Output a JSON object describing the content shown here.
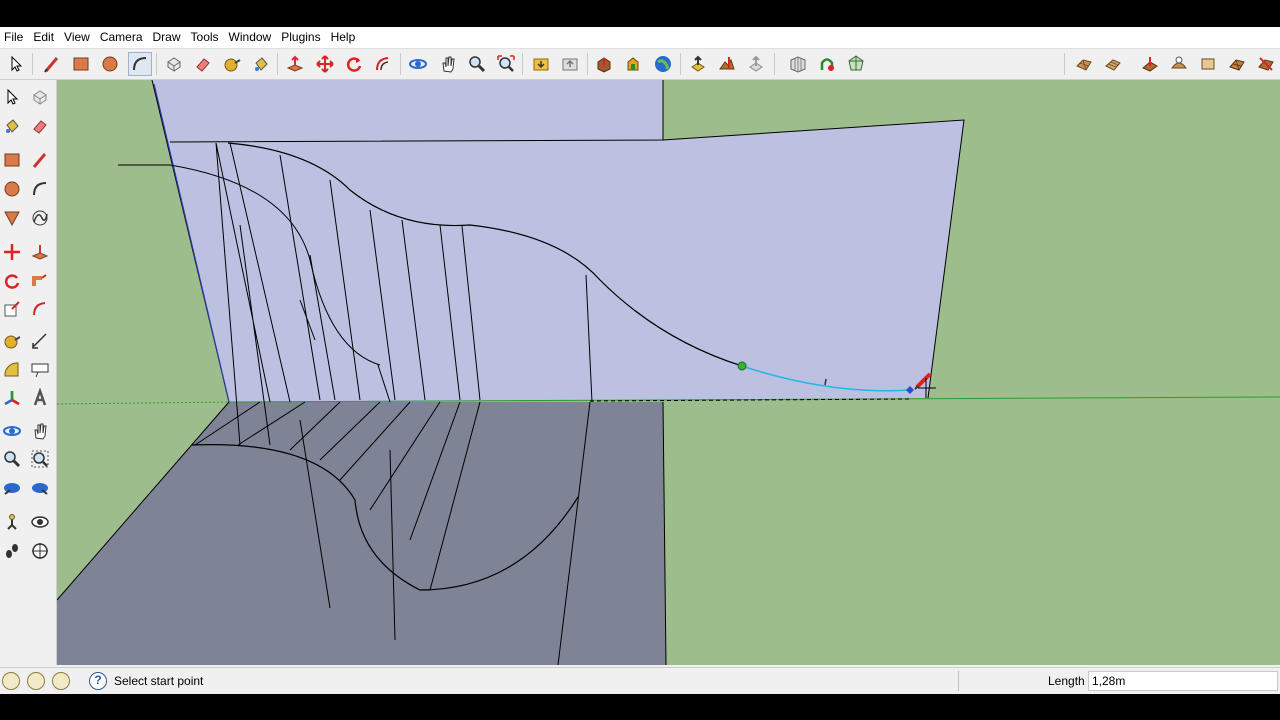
{
  "menu": [
    "File",
    "Edit",
    "View",
    "Camera",
    "Draw",
    "Tools",
    "Window",
    "Plugins",
    "Help"
  ],
  "toolbar": {
    "icons": [
      "select-icon",
      "line-icon",
      "rectangle-icon",
      "circle-icon",
      "arc-icon",
      "make-component-icon",
      "eraser-icon",
      "tape-measure-icon",
      "paint-bucket-icon",
      "push-pull-icon",
      "move-icon",
      "rotate-icon",
      "offset-icon",
      "orbit-icon",
      "pan-icon",
      "zoom-icon",
      "zoom-extents-icon",
      "warehouse-get-icon",
      "warehouse-share-icon",
      "share-component-icon",
      "extension-warehouse-icon",
      "google-earth-icon",
      "add-location-icon",
      "toggle-terrain-icon",
      "photo-texture-icon",
      "section-plane-icon",
      "section-display-icon",
      "section-fill-icon",
      "sandbox-icon",
      "from-contours-icon",
      "from-scratch-icon",
      "smoove-icon",
      "stamp-icon",
      "drape-icon",
      "add-detail-icon",
      "flip-edge-icon"
    ]
  },
  "colors": {
    "sky": "#9dbd8c",
    "wall": "#bcc1e2",
    "ground_plane": "#7f8396",
    "edge": "#000000",
    "axis_green": "#2e9a2e",
    "arc_preview": "#22b8e0"
  },
  "status": {
    "hint": "Select start point",
    "vcb_label": "Length",
    "vcb_value": "1,28m"
  }
}
